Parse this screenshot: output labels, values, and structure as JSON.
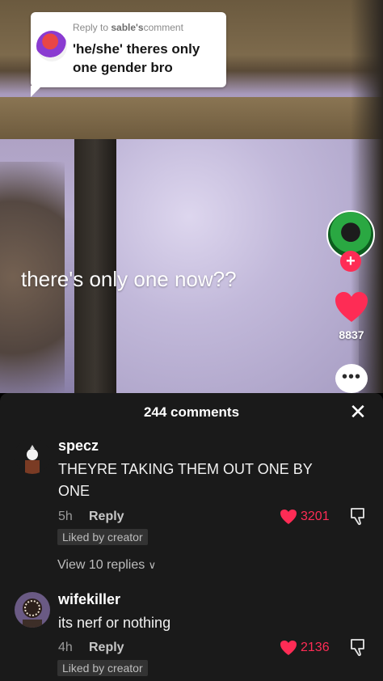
{
  "video": {
    "caption": "there's only one now??",
    "reply_bubble": {
      "prefix": "Reply to",
      "username": "sable's",
      "suffix": "comment",
      "text": "'he/she' theres only one gender bro"
    }
  },
  "actions": {
    "follow_label": "+",
    "like_count": "8837",
    "comment_icon": "ellipsis-icon"
  },
  "sheet": {
    "title": "244 comments",
    "close_label": "✕"
  },
  "comments": [
    {
      "username": "specz",
      "text": "THEYRE TAKING THEM OUT ONE BY ONE",
      "time": "5h",
      "reply_label": "Reply",
      "liked_label": "Liked by creator",
      "likes": "3201",
      "view_replies": "View 10 replies"
    },
    {
      "username": "wifekiller",
      "text": "its nerf or nothing",
      "time": "4h",
      "reply_label": "Reply",
      "liked_label": "Liked by creator",
      "likes": "2136"
    }
  ],
  "colors": {
    "accent": "#fe2c55",
    "sheet_bg": "#1a1a1a"
  }
}
